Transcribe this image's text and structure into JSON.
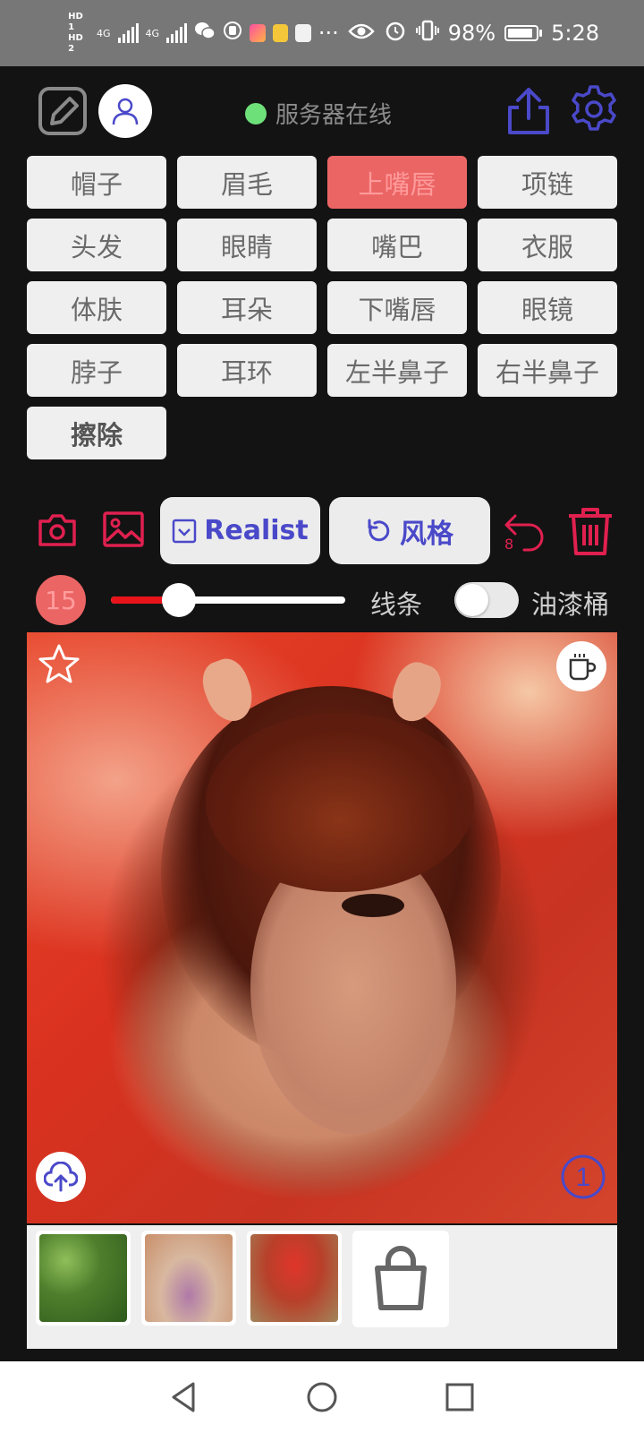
{
  "status_bar": {
    "hd1": "HD 1",
    "hd2": "HD 2",
    "signal1": "4G",
    "signal2": "4G",
    "more": "···",
    "battery": "98%",
    "time": "5:28"
  },
  "header": {
    "server_status": "服务器在线",
    "status_color": "#6ee07a"
  },
  "parts": [
    {
      "label": "帽子"
    },
    {
      "label": "眉毛"
    },
    {
      "label": "上嘴唇",
      "active": true
    },
    {
      "label": "项链"
    },
    {
      "label": "头发"
    },
    {
      "label": "眼睛"
    },
    {
      "label": "嘴巴"
    },
    {
      "label": "衣服"
    },
    {
      "label": "体肤"
    },
    {
      "label": "耳朵"
    },
    {
      "label": "下嘴唇"
    },
    {
      "label": "眼镜"
    },
    {
      "label": "脖子"
    },
    {
      "label": "耳环"
    },
    {
      "label": "左半鼻子"
    },
    {
      "label": "右半鼻子"
    },
    {
      "label": "擦除"
    }
  ],
  "toolbar": {
    "realist_label": "Realist",
    "style_label": "风格",
    "undo_count": "8"
  },
  "brush": {
    "size": "15",
    "slider_fraction": 0.29,
    "line_label": "线条",
    "bucket_label": "油漆桶",
    "bucket_enabled": false
  },
  "canvas": {
    "badge_number": "1"
  },
  "icons": {
    "edit": "edit-icon",
    "user": "user-icon",
    "share": "share-icon",
    "settings": "gear-icon",
    "camera": "camera-icon",
    "gallery": "image-icon",
    "undo": "undo-icon",
    "trash": "trash-icon",
    "favorite": "star-icon",
    "coffee": "cup-icon",
    "upload": "cloud-upload-icon",
    "bag": "bag-icon"
  },
  "colors": {
    "accent_red": "#e0204f",
    "chip_active": "#eb6565",
    "purple": "#4a49c9",
    "slider_fill": "#e8141a"
  }
}
